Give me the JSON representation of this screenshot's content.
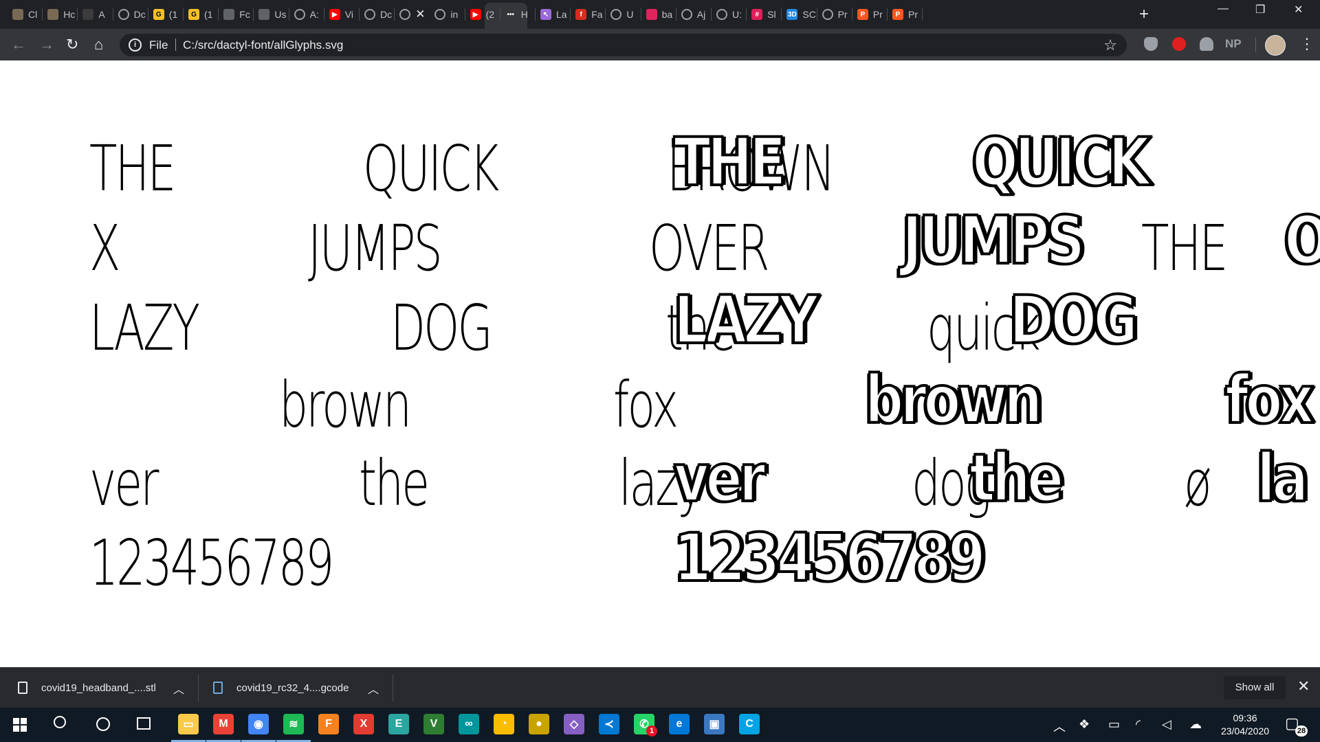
{
  "browser": {
    "tabs": [
      {
        "label": "Cl",
        "favicon_color": "#7a6a55",
        "glyph": ""
      },
      {
        "label": "Hc",
        "favicon_color": "#7a6a55",
        "glyph": ""
      },
      {
        "label": "A",
        "favicon_color": "#3c3c3c",
        "glyph": ""
      },
      {
        "label": "Dc",
        "favicon_color": "#5f6368",
        "glyph": "globe"
      },
      {
        "label": "(1",
        "favicon_color": "#f6c026",
        "glyph": "G"
      },
      {
        "label": "(1",
        "favicon_color": "#f6c026",
        "glyph": "G"
      },
      {
        "label": "Fc",
        "favicon_color": "#5f6368",
        "glyph": ""
      },
      {
        "label": "Us",
        "favicon_color": "#5f6368",
        "glyph": ""
      },
      {
        "label": "A:",
        "favicon_color": "#5f6368",
        "glyph": "globe"
      },
      {
        "label": "Vi",
        "favicon_color": "#ff0000",
        "glyph": "▶"
      },
      {
        "label": "Dc",
        "favicon_color": "#5f6368",
        "glyph": "globe"
      },
      {
        "label": "",
        "favicon_color": "#5f6368",
        "glyph": "globe",
        "active": true
      },
      {
        "label": "in",
        "favicon_color": "#5f6368",
        "glyph": "globe"
      },
      {
        "label": "(2",
        "favicon_color": "#ff0000",
        "glyph": "▶"
      },
      {
        "label": "H",
        "favicon_color": "#35363a",
        "glyph": "•••"
      },
      {
        "label": "La",
        "favicon_color": "#9c6ad8",
        "glyph": "↖"
      },
      {
        "label": "Fa",
        "favicon_color": "#d62d20",
        "glyph": "f"
      },
      {
        "label": "U",
        "favicon_color": "#5f6368",
        "glyph": "globe"
      },
      {
        "label": "ba",
        "favicon_color": "#e0245e",
        "glyph": ""
      },
      {
        "label": "Aj",
        "favicon_color": "#5f6368",
        "glyph": "globe"
      },
      {
        "label": "U:",
        "favicon_color": "#5f6368",
        "glyph": "globe"
      },
      {
        "label": "Sl",
        "favicon_color": "#e01e5a",
        "glyph": "#"
      },
      {
        "label": "SC",
        "favicon_color": "#1e88e5",
        "glyph": "3D"
      },
      {
        "label": "Pr",
        "favicon_color": "#5f6368",
        "glyph": "globe"
      },
      {
        "label": "Pr",
        "favicon_color": "#ff5722",
        "glyph": "P"
      },
      {
        "label": "Pr",
        "favicon_color": "#ff5722",
        "glyph": "P"
      }
    ],
    "active_tab_close": "✕",
    "new_tab": "+",
    "window": {
      "minimize": "—",
      "restore": "❐",
      "close": "✕"
    },
    "toolbar": {
      "back": "←",
      "forward": "→",
      "reload": "↻",
      "home": "⌂",
      "scheme_label": "File",
      "url": "C:/src/dactyl-font/allGlyphs.svg",
      "bookmark": "☆",
      "profile_initials": "NP",
      "menu": "⋮"
    }
  },
  "page": {
    "thin_words": [
      "THE",
      "QUICK",
      "BROWN",
      "X",
      "JUMPS",
      "OVER",
      "THE",
      "LAZY",
      "DOG",
      "the",
      "quick",
      "brown",
      "fox",
      "ver",
      "the",
      "lazy",
      "dog",
      "ø",
      "123456789"
    ],
    "bold_words": [
      "THE",
      "QUICK",
      "JUMPS",
      "OX",
      "LAZY",
      "DOG",
      "brown",
      "fox",
      "ver",
      "the",
      "la",
      "123456789"
    ]
  },
  "downloads": {
    "items": [
      {
        "filename": "covid19_headband_....stl"
      },
      {
        "filename": "covid19_rc32_4....gcode"
      }
    ],
    "show_all": "Show all",
    "close": "✕"
  },
  "taskbar": {
    "apps": [
      {
        "name": "file-explorer",
        "color": "#f8c94a",
        "glyph": "▭"
      },
      {
        "name": "gmail",
        "color": "#ea4335",
        "glyph": "M"
      },
      {
        "name": "chrome",
        "color": "#4285f4",
        "glyph": "◉"
      },
      {
        "name": "spotify",
        "color": "#1db954",
        "glyph": "≋"
      },
      {
        "name": "fusion",
        "color": "#f58220",
        "glyph": "F"
      },
      {
        "name": "xmind",
        "color": "#e03c31",
        "glyph": "X"
      },
      {
        "name": "terminal",
        "color": "#2ba5a0",
        "glyph": "E"
      },
      {
        "name": "vim",
        "color": "#2e7d32",
        "glyph": "V"
      },
      {
        "name": "arduino",
        "color": "#00979c",
        "glyph": "∞"
      },
      {
        "name": "keep",
        "color": "#fbbc04",
        "glyph": "◔"
      },
      {
        "name": "globe-app",
        "color": "#c9a400",
        "glyph": "●"
      },
      {
        "name": "visual-studio",
        "color": "#865fc5",
        "glyph": "◇"
      },
      {
        "name": "vscode",
        "color": "#0078d4",
        "glyph": "≺"
      },
      {
        "name": "whatsapp",
        "color": "#25d366",
        "glyph": "✆"
      },
      {
        "name": "edge",
        "color": "#0078d7",
        "glyph": "e"
      },
      {
        "name": "window-app",
        "color": "#3b78c2",
        "glyph": "▣"
      },
      {
        "name": "ccleaner",
        "color": "#00a4e4",
        "glyph": "C"
      }
    ],
    "whatsapp_badge": "1",
    "clock_time": "09:36",
    "clock_date": "23/04/2020",
    "notifications_count": "28"
  }
}
